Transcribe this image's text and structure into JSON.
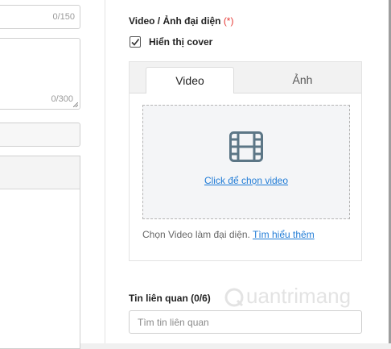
{
  "left_form": {
    "title_counter": "0/150",
    "description_counter": "0/300"
  },
  "media": {
    "label": "Video / Ảnh đại diện",
    "required_mark": "(*)",
    "show_cover_label": "Hiển thị cover",
    "show_cover_checked": true,
    "tabs": [
      {
        "label": "Video",
        "active": true
      },
      {
        "label": "Ảnh",
        "active": false
      }
    ],
    "dropzone_link": "Click để chọn video",
    "help_text": "Chọn Video làm đại diện. ",
    "help_link": "Tìm hiểu thêm"
  },
  "related": {
    "label": "Tin liên quan (0/6)",
    "placeholder": "Tìm tin liên quan"
  },
  "watermark": {
    "text": "uantrimang"
  },
  "colors": {
    "link": "#1f7bd6",
    "required": "#e53935",
    "tab_bar": "#f2f2f2",
    "dropzone": "#f4f5f7"
  },
  "icons": [
    "checkmark-icon",
    "film-icon",
    "quantrimang-logo-icon"
  ]
}
